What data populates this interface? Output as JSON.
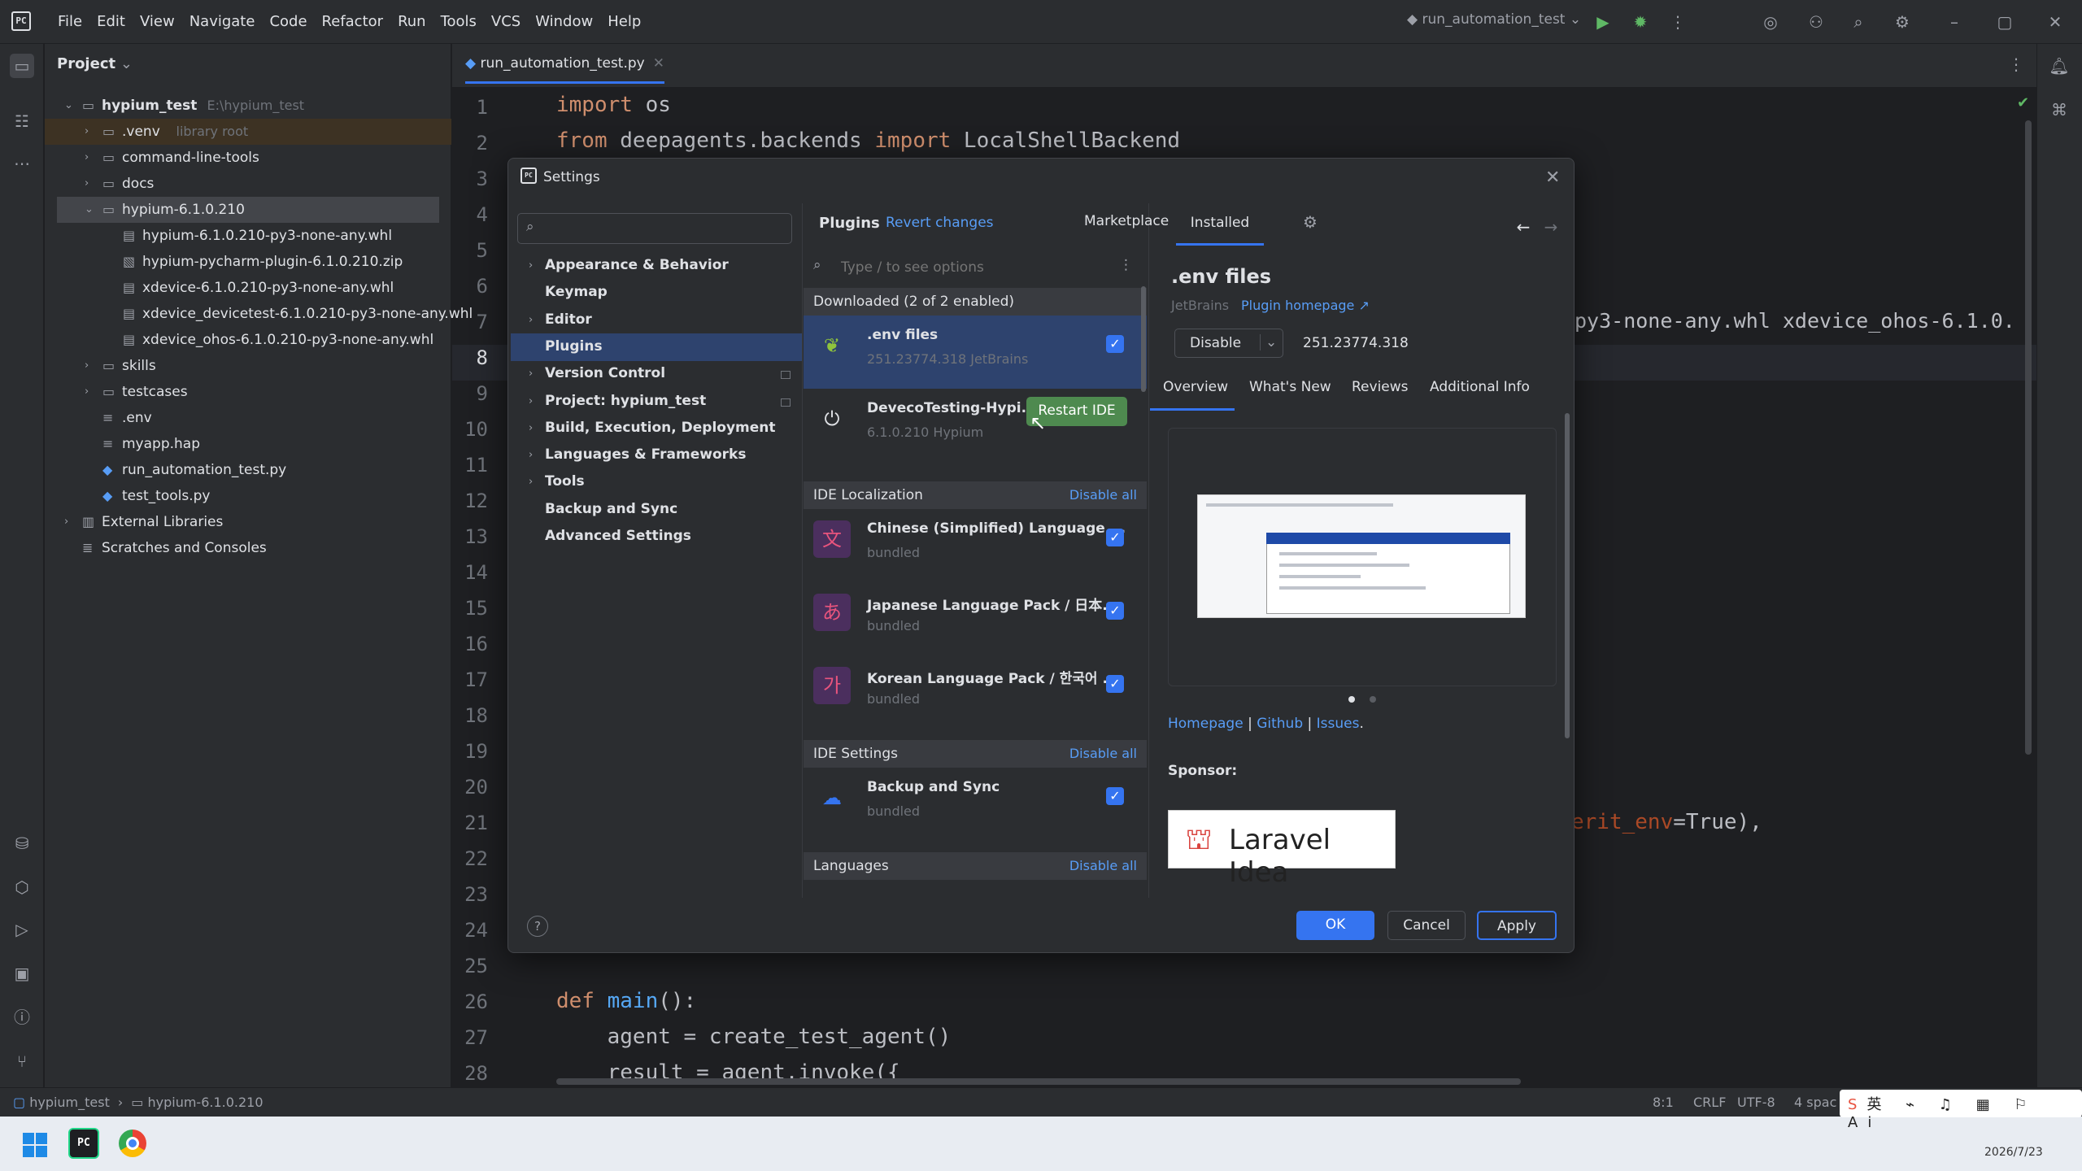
{
  "menu": [
    "File",
    "Edit",
    "View",
    "Navigate",
    "Code",
    "Refactor",
    "Run",
    "Tools",
    "VCS",
    "Window",
    "Help"
  ],
  "run_config": "run_automation_test",
  "project": {
    "title": "Project",
    "tree": [
      {
        "label": "hypium_test",
        "hint": "E:\\hypium_test",
        "indent": 0,
        "arrow": "v",
        "icon": "folder",
        "bold": true
      },
      {
        "label": ".venv",
        "hint": "library root",
        "indent": 1,
        "arrow": ">",
        "icon": "folder"
      },
      {
        "label": "command-line-tools",
        "hint": "",
        "indent": 1,
        "arrow": ">",
        "icon": "folder"
      },
      {
        "label": "docs",
        "hint": "",
        "indent": 1,
        "arrow": ">",
        "icon": "folder"
      },
      {
        "label": "hypium-6.1.0.210",
        "hint": "",
        "indent": 1,
        "arrow": "v",
        "icon": "folder",
        "selected": true
      },
      {
        "label": "hypium-6.1.0.210-py3-none-any.whl",
        "hint": "",
        "indent": 2,
        "arrow": "",
        "icon": "file"
      },
      {
        "label": "hypium-pycharm-plugin-6.1.0.210.zip",
        "hint": "",
        "indent": 2,
        "arrow": "",
        "icon": "zip"
      },
      {
        "label": "xdevice-6.1.0.210-py3-none-any.whl",
        "hint": "",
        "indent": 2,
        "arrow": "",
        "icon": "file"
      },
      {
        "label": "xdevice_devicetest-6.1.0.210-py3-none-any.whl",
        "hint": "",
        "indent": 2,
        "arrow": "",
        "icon": "file"
      },
      {
        "label": "xdevice_ohos-6.1.0.210-py3-none-any.whl",
        "hint": "",
        "indent": 2,
        "arrow": "",
        "icon": "file"
      },
      {
        "label": "skills",
        "hint": "",
        "indent": 1,
        "arrow": ">",
        "icon": "folder"
      },
      {
        "label": "testcases",
        "hint": "",
        "indent": 1,
        "arrow": ">",
        "icon": "folder"
      },
      {
        "label": ".env",
        "hint": "",
        "indent": 1,
        "arrow": "",
        "icon": "text"
      },
      {
        "label": "myapp.hap",
        "hint": "",
        "indent": 1,
        "arrow": "",
        "icon": "text"
      },
      {
        "label": "run_automation_test.py",
        "hint": "",
        "indent": 1,
        "arrow": "",
        "icon": "py"
      },
      {
        "label": "test_tools.py",
        "hint": "",
        "indent": 1,
        "arrow": "",
        "icon": "py"
      },
      {
        "label": "External Libraries",
        "hint": "",
        "indent": 0,
        "arrow": ">",
        "icon": "lib"
      },
      {
        "label": "Scratches and Consoles",
        "hint": "",
        "indent": 0,
        "arrow": "",
        "icon": "scratch"
      }
    ]
  },
  "editor": {
    "tab": "run_automation_test.py",
    "line_numbers": [
      "1",
      "2",
      "3",
      "4",
      "5",
      "6",
      "7",
      "8",
      "9",
      "10",
      "11",
      "12",
      "13",
      "14",
      "15",
      "16",
      "17",
      "18",
      "19",
      "20",
      "21",
      "22",
      "23",
      "24",
      "25",
      "26",
      "27",
      "28"
    ],
    "visible_fragments": {
      "l1_kw": "import",
      "l1_rest": " os",
      "l2_kw1": "from",
      "l2_mid": " deepagents.backends ",
      "l2_kw2": "import",
      "l2_rest": " LocalShellBackend",
      "l7_tail": "py3-none-any.whl xdevice_ohos-6.1.0.",
      "l21_tail_a": "erit_env",
      "l21_tail_b": "=True),",
      "l26_kw": "def",
      "l26_fn": " main",
      "l26_rest": "():",
      "l27": "    agent = create_test_agent()",
      "l28": "    result = agent.invoke({"
    }
  },
  "status": {
    "breadcrumb": [
      "hypium_test",
      "hypium-6.1.0.210"
    ],
    "position": "8:1",
    "line_sep": "CRLF",
    "encoding": "UTF-8",
    "indent": "4 spac"
  },
  "taskbar": {
    "date": "2026/7/23"
  },
  "settings": {
    "title": "Settings",
    "search_placeholder": "",
    "nav": [
      {
        "label": "Appearance & Behavior",
        "arrow": true
      },
      {
        "label": "Keymap",
        "arrow": false
      },
      {
        "label": "Editor",
        "arrow": true
      },
      {
        "label": "Plugins",
        "arrow": false,
        "selected": true
      },
      {
        "label": "Version Control",
        "arrow": true
      },
      {
        "label": "Project: hypium_test",
        "arrow": true
      },
      {
        "label": "Build, Execution, Deployment",
        "arrow": true
      },
      {
        "label": "Languages & Frameworks",
        "arrow": true
      },
      {
        "label": "Tools",
        "arrow": true
      },
      {
        "label": "Backup and Sync",
        "arrow": false
      },
      {
        "label": "Advanced Settings",
        "arrow": false
      }
    ],
    "plugins_header": "Plugins",
    "revert": "Revert changes",
    "tabs": {
      "marketplace": "Marketplace",
      "installed": "Installed"
    },
    "plugin_search_placeholder": "Type / to see options",
    "sections": [
      {
        "title": "Downloaded (2 of 2 enabled)",
        "disable_all": ""
      },
      {
        "title": "IDE Localization",
        "disable_all": "Disable all"
      },
      {
        "title": "IDE Settings",
        "disable_all": "Disable all"
      },
      {
        "title": "Languages",
        "disable_all": "Disable all"
      }
    ],
    "plugins": [
      {
        "name": ".env files",
        "sub": "251.23774.318   JetBrains",
        "checked": true
      },
      {
        "name": "DevecoTesting-Hypi...",
        "sub": "6.1.0.210   Hypium",
        "restart": "Restart IDE"
      },
      {
        "name": "Chinese (Simplified) Language ...",
        "sub": "bundled",
        "checked": true
      },
      {
        "name": "Japanese Language Pack / 日本...",
        "sub": "bundled",
        "checked": true
      },
      {
        "name": "Korean Language Pack / 한국어 ...",
        "sub": "bundled",
        "checked": true
      },
      {
        "name": "Backup and Sync",
        "sub": "bundled",
        "checked": true
      }
    ],
    "detail": {
      "name": ".env files",
      "vendor": "JetBrains",
      "homepage": "Plugin homepage ↗",
      "disable": "Disable",
      "version": "251.23774.318",
      "tabs": [
        "Overview",
        "What's New",
        "Reviews",
        "Additional Info"
      ],
      "links": [
        "Homepage",
        "Github",
        "Issues"
      ],
      "sponsor": "Sponsor:",
      "sponsor_name": "Laravel Idea"
    },
    "buttons": {
      "ok": "OK",
      "cancel": "Cancel",
      "apply": "Apply",
      "help": "?"
    }
  },
  "colors": {
    "accent": "#3574f0",
    "link": "#589df6",
    "selection": "#2e436e"
  }
}
